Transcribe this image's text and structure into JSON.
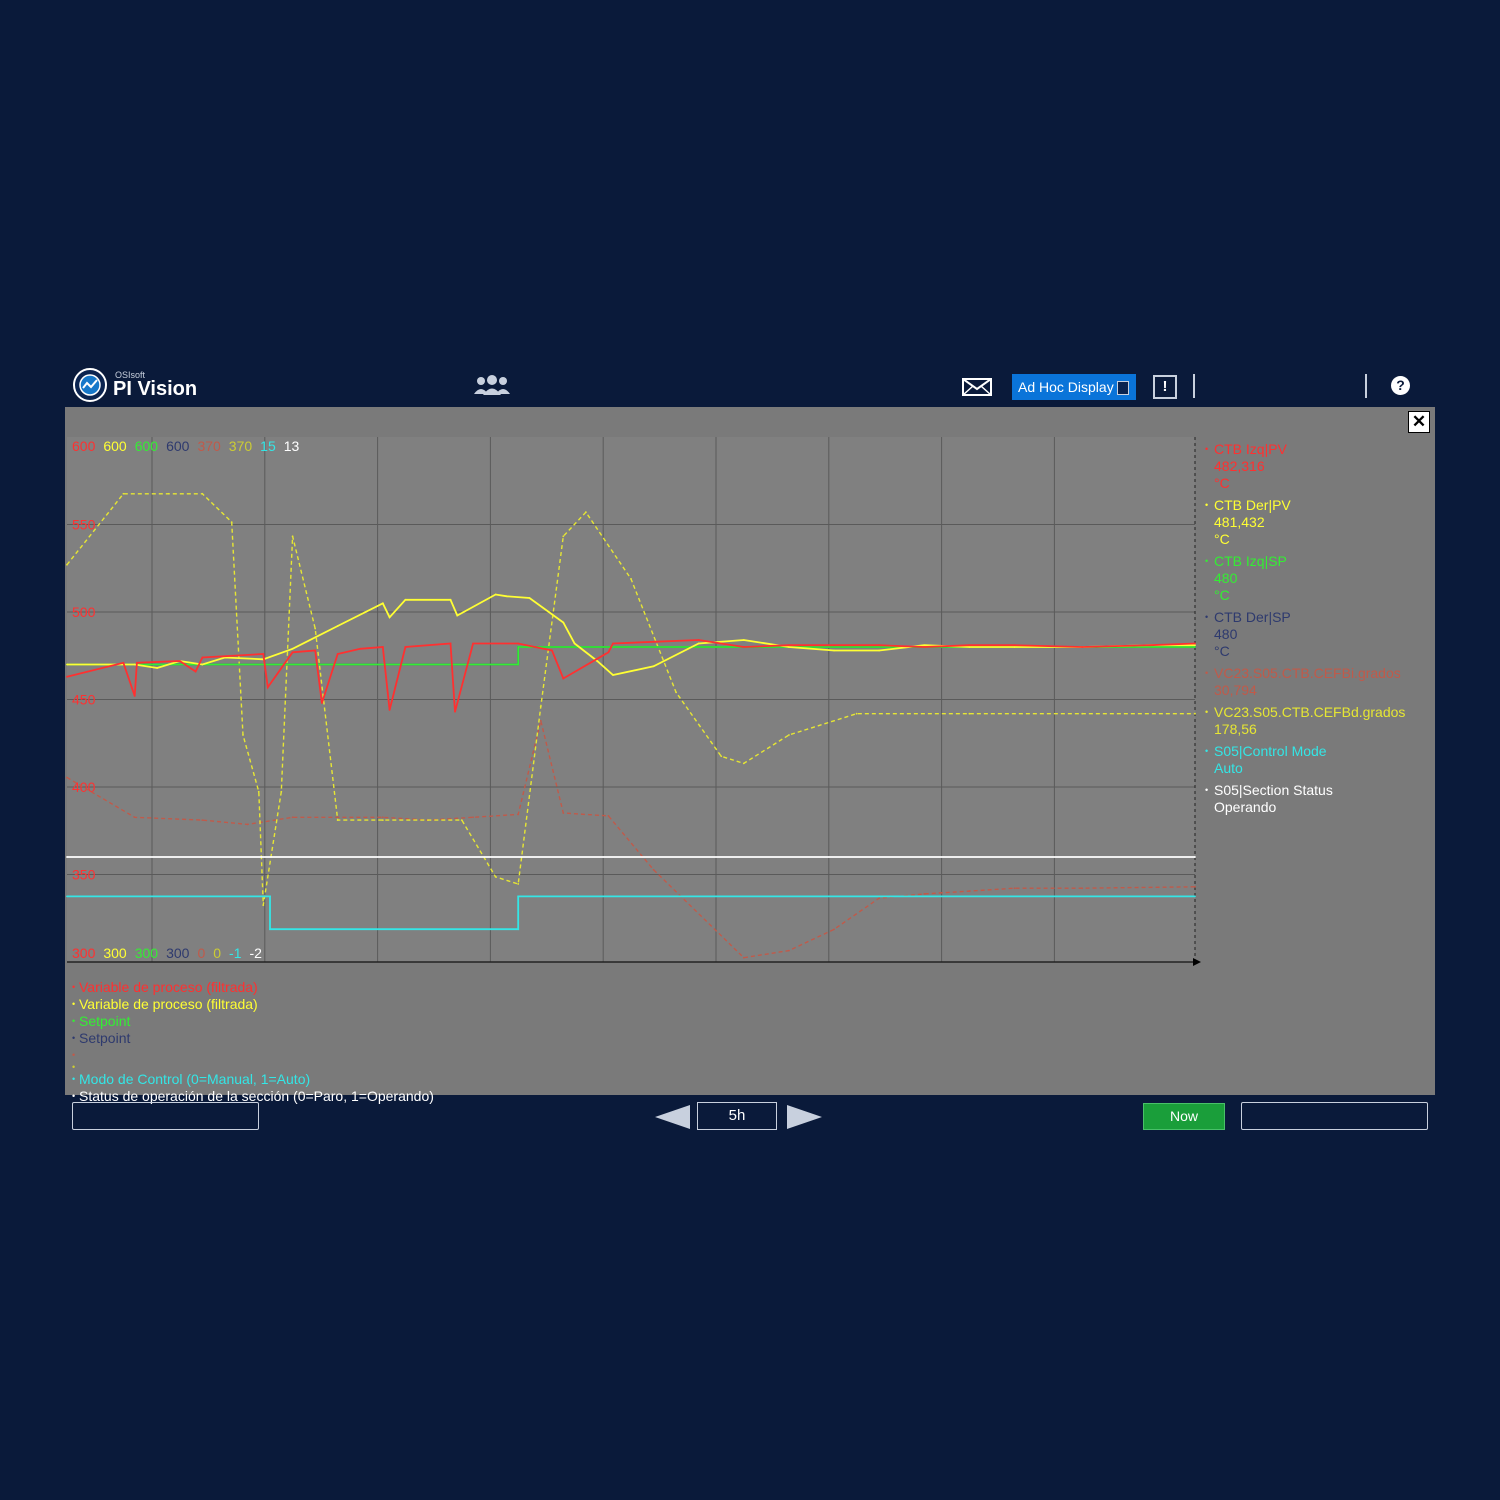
{
  "header": {
    "brand_small": "OSIsoft",
    "brand_name": "PI Vision",
    "adhoc_label": "Ad Hoc Display",
    "alert_label": "!",
    "help_label": "?",
    "icons": [
      "pi-vision-logo-icon",
      "users-icon",
      "mail-icon",
      "pin-icon",
      "alert-icon",
      "help-icon"
    ]
  },
  "panel": {
    "close_label": "✕",
    "scale_top": [
      {
        "text": "600",
        "color": "#ff3030"
      },
      {
        "text": "600",
        "color": "#ffff33"
      },
      {
        "text": "600",
        "color": "#33ee33"
      },
      {
        "text": "600",
        "color": "#2e3a6e"
      },
      {
        "text": "370",
        "color": "#c05a4a"
      },
      {
        "text": "370",
        "color": "#cccc33"
      },
      {
        "text": "15",
        "color": "#33e6e6"
      },
      {
        "text": "13",
        "color": "#ffffff"
      }
    ],
    "scale_bottom": [
      {
        "text": "300",
        "color": "#ff3030"
      },
      {
        "text": "300",
        "color": "#ffff33"
      },
      {
        "text": "300",
        "color": "#33ee33"
      },
      {
        "text": "300",
        "color": "#2e3a6e"
      },
      {
        "text": "0",
        "color": "#c05a4a"
      },
      {
        "text": "0",
        "color": "#cccc33"
      },
      {
        "text": "-1",
        "color": "#33e6e6"
      },
      {
        "text": "-2",
        "color": "#ffffff"
      }
    ],
    "tags": [
      {
        "name": "CTB Izq|PV",
        "value": "482,316",
        "unit": "°C",
        "color": "#ff3030"
      },
      {
        "name": "CTB Der|PV",
        "value": "481,432",
        "unit": "°C",
        "color": "#ffff33"
      },
      {
        "name": "CTB Izq|SP",
        "value": "480",
        "unit": "°C",
        "color": "#33ee33"
      },
      {
        "name": "CTB Der|SP",
        "value": "480",
        "unit": "°C",
        "color": "#2e3a6e"
      },
      {
        "name": "VC23.S05.CTB.CEFBi.grados",
        "value": "30,794",
        "unit": "",
        "color": "#c05a4a"
      },
      {
        "name": "VC23.S05.CTB.CEFBd.grados",
        "value": "178,56",
        "unit": "",
        "color": "#e6e633"
      },
      {
        "name": "S05|Control Mode",
        "value": "Auto",
        "unit": "",
        "color": "#33e6e6"
      },
      {
        "name": "S05|Section Status",
        "value": "Operando",
        "unit": "",
        "color": "#ffffff"
      }
    ],
    "descriptions": [
      {
        "text": "Variable de proceso (filtrada)",
        "color": "#ff3030"
      },
      {
        "text": "Variable de proceso (filtrada)",
        "color": "#ffff33"
      },
      {
        "text": "Setpoint",
        "color": "#33ee33"
      },
      {
        "text": "Setpoint",
        "color": "#2e3a6e"
      },
      {
        "text": "",
        "color": "#c05a4a"
      },
      {
        "text": "",
        "color": "#cccc33"
      },
      {
        "text": "Modo de Control (0=Manual, 1=Auto)",
        "color": "#33e6e6"
      },
      {
        "text": "Status de operación de la sección (0=Paro, 1=Operando)",
        "color": "#ffffff"
      }
    ]
  },
  "footer": {
    "duration": "5h",
    "now_label": "Now",
    "start_time": "",
    "end_time": ""
  },
  "chart_data": {
    "type": "line",
    "y_ticks": [
      "550",
      "500",
      "450",
      "400",
      "350"
    ],
    "y_tick_color": "#ff3030",
    "ylim": [
      300,
      600
    ],
    "xlim": [
      0,
      5
    ],
    "x_unit": "hours",
    "grid": true,
    "legend": "right",
    "series": [
      {
        "name": "CTB Izq|PV",
        "color": "#ff3030",
        "style": "solid",
        "axis": [
          300,
          600
        ],
        "x": [
          0,
          0.25,
          0.3,
          0.31,
          0.5,
          0.57,
          0.6,
          0.87,
          0.89,
          1.0,
          1.1,
          1.13,
          1.2,
          1.3,
          1.4,
          1.43,
          1.5,
          1.7,
          1.72,
          1.8,
          2.0,
          2.15,
          2.2,
          2.4,
          2.42,
          2.6,
          2.8,
          3.0,
          3.2,
          3.4,
          3.6,
          3.8,
          4.0,
          4.2,
          4.5,
          4.8,
          5.0
        ],
        "y": [
          463,
          471,
          452,
          471,
          472,
          466,
          474,
          476,
          457,
          477,
          478,
          448,
          476,
          479,
          480,
          444,
          480,
          482,
          443,
          482,
          482,
          478,
          462,
          477,
          482,
          483,
          484,
          480,
          481,
          481,
          481,
          480,
          481,
          481,
          480,
          481,
          482
        ]
      },
      {
        "name": "CTB Der|PV",
        "color": "#ffff33",
        "style": "solid",
        "axis": [
          300,
          600
        ],
        "x": [
          0,
          0.3,
          0.4,
          0.5,
          0.6,
          0.7,
          0.87,
          1.0,
          1.2,
          1.4,
          1.43,
          1.5,
          1.7,
          1.73,
          1.9,
          1.95,
          2.05,
          2.2,
          2.25,
          2.35,
          2.42,
          2.6,
          2.8,
          3.0,
          3.2,
          3.4,
          3.6,
          3.8,
          4.0,
          4.2,
          4.5,
          4.8,
          5.0
        ],
        "y": [
          470,
          470,
          468,
          472,
          470,
          474,
          473,
          479,
          492,
          505,
          497,
          507,
          507,
          498,
          510,
          509,
          508,
          494,
          482,
          472,
          464,
          469,
          482,
          484,
          480,
          478,
          478,
          481,
          480,
          480,
          480,
          481,
          481
        ]
      },
      {
        "name": "CTB Izq|SP",
        "color": "#33ee33",
        "style": "solid",
        "axis": [
          300,
          600
        ],
        "x": [
          0,
          2.0,
          2.0,
          5.0
        ],
        "y": [
          470,
          470,
          480,
          480
        ]
      },
      {
        "name": "CTB Der|SP",
        "color": "#2e3a6e",
        "style": "solid",
        "axis": [
          300,
          600
        ],
        "x": [
          0,
          2.0,
          2.0,
          5.0
        ],
        "y": [
          470,
          470,
          480,
          480
        ]
      },
      {
        "name": "VC23.S05.CTB.CEFBi.grados",
        "color": "#c05a4a",
        "style": "dashed",
        "axis": [
          0,
          370
        ],
        "x": [
          0,
          0.3,
          0.6,
          0.8,
          1.0,
          1.2,
          1.4,
          1.6,
          1.8,
          2.0,
          2.1,
          2.2,
          2.4,
          2.6,
          3.0,
          3.2,
          3.4,
          3.6,
          3.8,
          4.0,
          4.2,
          4.5,
          5.0
        ],
        "y": [
          130,
          102,
          100,
          97,
          102,
          102,
          102,
          100,
          102,
          104,
          170,
          105,
          103,
          65,
          3,
          8,
          23,
          45,
          48,
          50,
          52,
          52,
          53
        ]
      },
      {
        "name": "VC23.S05.CTB.CEFBd.grados",
        "color": "#e6e633",
        "style": "dashed",
        "axis": [
          0,
          370
        ],
        "x": [
          0,
          0.25,
          0.45,
          0.6,
          0.73,
          0.78,
          0.85,
          0.87,
          0.95,
          1.0,
          1.1,
          1.2,
          1.4,
          1.6,
          1.75,
          1.9,
          2.0,
          2.1,
          2.2,
          2.3,
          2.5,
          2.7,
          2.9,
          3.0,
          3.2,
          3.5,
          4.0,
          4.5,
          5.0
        ],
        "y": [
          280,
          330,
          330,
          330,
          310,
          160,
          120,
          40,
          120,
          300,
          235,
          100,
          100,
          100,
          100,
          60,
          55,
          180,
          300,
          317,
          270,
          190,
          145,
          140,
          160,
          175,
          175,
          175,
          175
        ]
      },
      {
        "name": "S05|Control Mode",
        "color": "#33e6e6",
        "style": "solid",
        "axis": [
          -1,
          15
        ],
        "x": [
          0,
          0.9,
          0.9,
          2.0,
          2.0,
          5.0
        ],
        "y": [
          1,
          1,
          0,
          0,
          1,
          1
        ]
      },
      {
        "name": "S05|Section Status",
        "color": "#ffffff",
        "style": "solid",
        "axis": [
          -2,
          13
        ],
        "x": [
          0,
          5.0
        ],
        "y": [
          1,
          1
        ]
      }
    ]
  }
}
